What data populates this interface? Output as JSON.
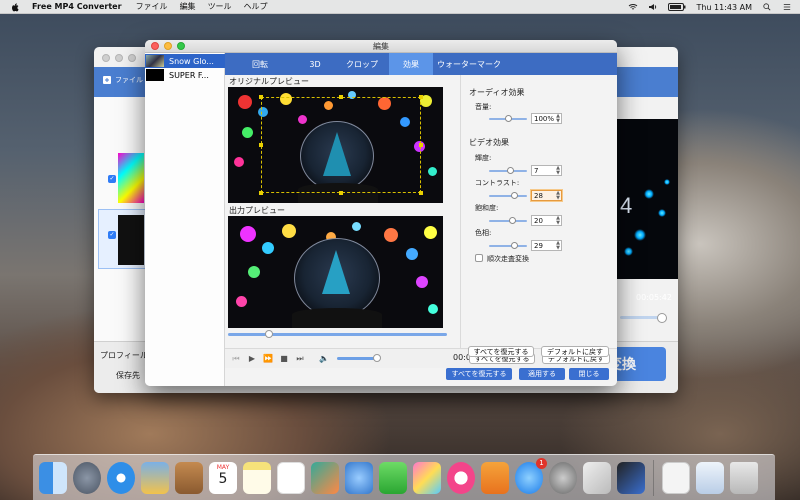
{
  "menubar": {
    "app_name": "Free MP4 Converter",
    "menus": [
      "ファイル",
      "編集",
      "ツール",
      "ヘルプ"
    ],
    "clock": "Thu 11:43 AM"
  },
  "main_window": {
    "file_button_label": "ファイル",
    "profile_label": "プロフィール",
    "save_label": "保存先",
    "time_main": "00:05:42",
    "convert_button_label": "変換",
    "overlay_text": "4"
  },
  "dialog": {
    "title": "編集",
    "sidebar_items": [
      {
        "label": "Snow Glo..."
      },
      {
        "label": "SUPER F..."
      }
    ],
    "tabs": [
      {
        "label": "回転"
      },
      {
        "label": "3D"
      },
      {
        "label": "クロップ"
      },
      {
        "label": "効果"
      },
      {
        "label": "ウォーターマーク"
      }
    ],
    "active_tab": "効果",
    "original_preview_label": "オリジナルプレビュー",
    "output_preview_label": "出力プレビュー",
    "timecode": "00:00:17/00:01:32",
    "playback_progress": 0.17,
    "volume_level": 0.85,
    "audio_section": "オーディオ効果",
    "volume_label": "音量:",
    "volume_value": "100%",
    "video_section": "ビデオ効果",
    "brightness_label": "輝度:",
    "brightness_value": "7",
    "contrast_label": "コントラスト:",
    "contrast_value": "28",
    "saturation_label": "飽和度:",
    "saturation_value": "20",
    "hue_label": "色相:",
    "hue_value": "29",
    "deinterlace_label": "順次走査変換",
    "reset_all_button": "すべてを復元する",
    "restore_default_button": "デフォルトに戻す",
    "footer_reset_button": "すべてを復元する",
    "apply_button": "適用する",
    "close_button": "閉じる"
  },
  "dock": {
    "calendar_month": "MAY",
    "calendar_day": "5",
    "app_store_badge": "1"
  },
  "colors": {
    "accent_blue": "#3d6cc2",
    "active_tab": "#5c95e8",
    "focus_orange": "#e69a3e",
    "button_blue": "#3a6fd0"
  }
}
